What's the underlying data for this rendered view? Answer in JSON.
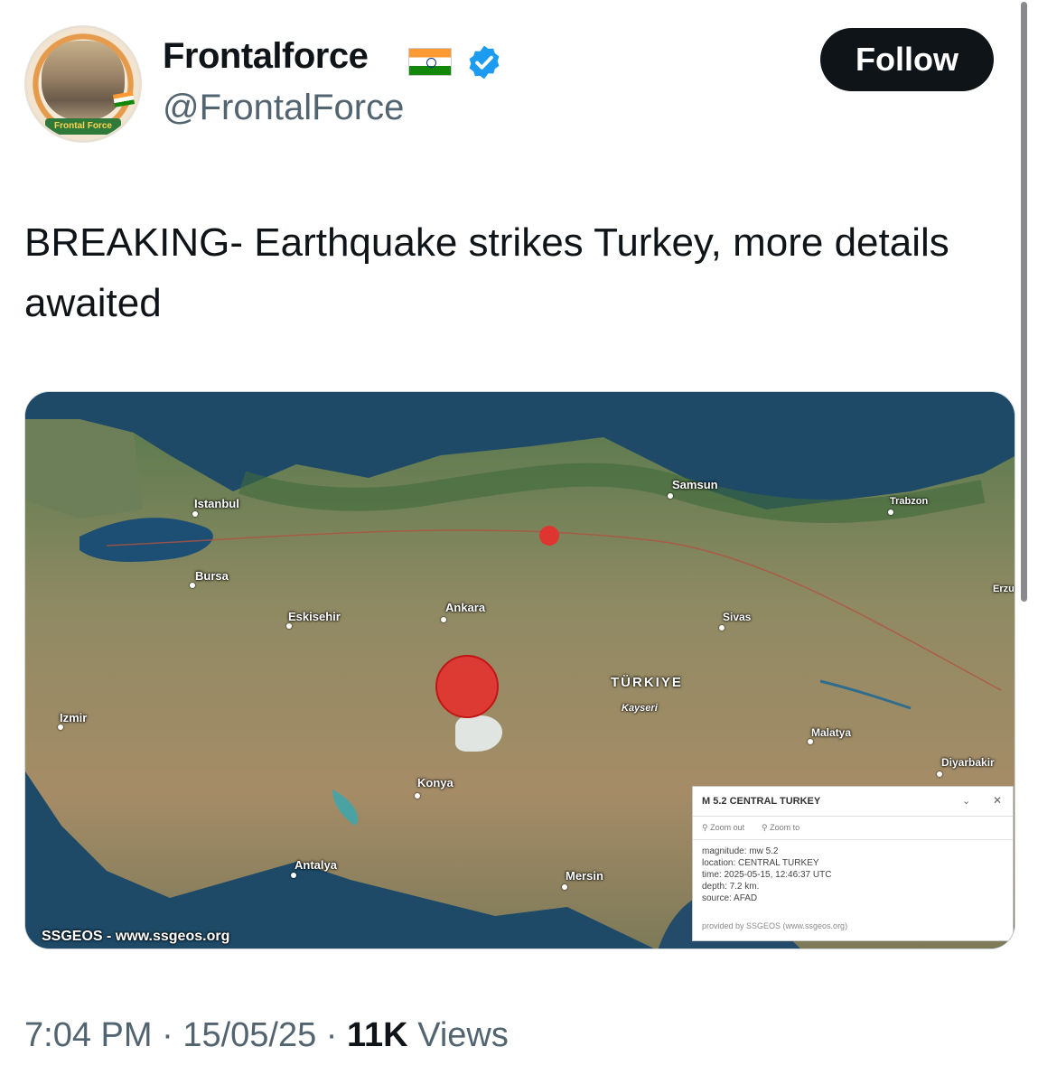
{
  "author": {
    "avatar_label": "Frontal Force",
    "display_name": "Frontalforce",
    "handle": "@FrontalForce",
    "flag_icon": "india-flag-icon",
    "verified_icon": "verified-badge-icon",
    "verified_color": "#1d9bf0"
  },
  "follow_label": "Follow",
  "tweet": {
    "text": "BREAKING- Earthquake strikes Turkey, more details awaited"
  },
  "map": {
    "country": "TÜRKIYE",
    "cities": {
      "istanbul": "Istanbul",
      "bursa": "Bursa",
      "eskisehir": "Eskisehir",
      "ankara": "Ankara",
      "samsun": "Samsun",
      "trabzon": "Trabzon",
      "erzurum": "Erzu",
      "sivas": "Sivas",
      "kayseri": "Kayseri",
      "malatya": "Malatya",
      "diyarbakir": "Diyarbakir",
      "izmir": "Izmir",
      "konya": "Konya",
      "antalya": "Antalya",
      "mersin": "Mersin"
    },
    "watermark": "SSGEOS - www.ssgeos.org",
    "epicenter_color": "#e92c2c",
    "popup": {
      "title": "M 5.2 CENTRAL TURKEY",
      "zoom_out": "Zoom out",
      "zoom_to": "Zoom to",
      "magnitude": "magnitude: mw 5.2",
      "location": "location: CENTRAL TURKEY",
      "time": "time: 2025-05-15, 12:46:37 UTC",
      "depth": "depth: 7.2 km.",
      "source": "source: AFAD",
      "credit": "provided by SSGEOS (www.ssgeos.org)"
    }
  },
  "meta": {
    "time": "7:04 PM",
    "sep1": " · ",
    "date": "15/05/25",
    "sep2": " · ",
    "views_count": "11K",
    "views_label": " Views"
  }
}
